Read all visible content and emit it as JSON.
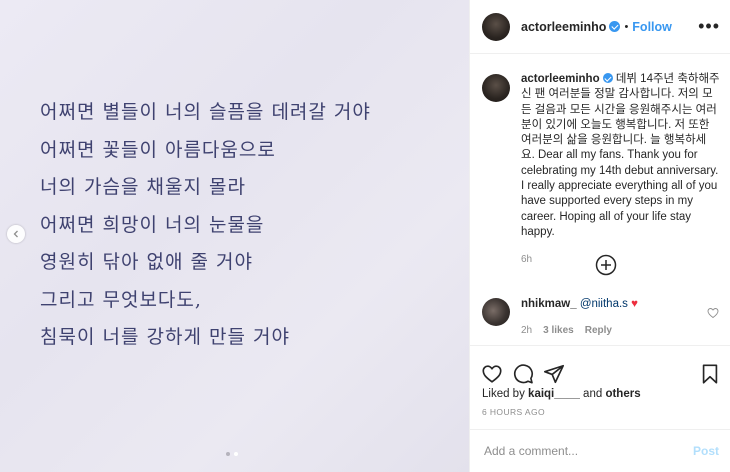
{
  "post_image": {
    "poem_lines": [
      "어쩌면 별들이 너의 슬픔을 데려갈 거야",
      "어쩌면 꽃들이 아름다움으로",
      "너의 가슴을 채울지 몰라",
      "어쩌면 희망이 너의 눈물을",
      "영원히 닦아 없애 줄 거야",
      "그리고 무엇보다도,",
      "침묵이 너를 강하게 만들 거야"
    ],
    "carousel_index": 2,
    "carousel_total": 2
  },
  "header": {
    "username": "actorleeminho",
    "follow_label": "Follow",
    "more_label": "•••"
  },
  "caption": {
    "username": "actorleeminho",
    "text": "데뷔 14주년 축하해주신 팬 여러분들 정말 감사합니다. 저의 모든 걸음과 모든 시간을 응원해주시는 여러분이 있기에 오늘도 행복합니다. 저 또한 여러분의 삶을 응원합니다. 늘 행복하세요. Dear all my fans. Thank you for celebrating my 14th debut anniversary. I really appreciate everything all of you have supported every steps in my career. Hoping all of your life stay happy.",
    "time": "6h"
  },
  "comment": {
    "username": "nhikmaw_",
    "mention": "@niitha.s",
    "emoji": "♥",
    "time": "2h",
    "likes": "3 likes",
    "reply_label": "Reply"
  },
  "likes": {
    "prefix": "Liked by",
    "user": "kaiqi____",
    "suffix": "and",
    "others": "others"
  },
  "posted_time": "6 HOURS AGO",
  "comment_input": {
    "placeholder": "Add a comment...",
    "post_label": "Post"
  },
  "colors": {
    "accent": "#3897f0",
    "poem_text": "#3f4270",
    "heart": "#ed2e3e"
  }
}
